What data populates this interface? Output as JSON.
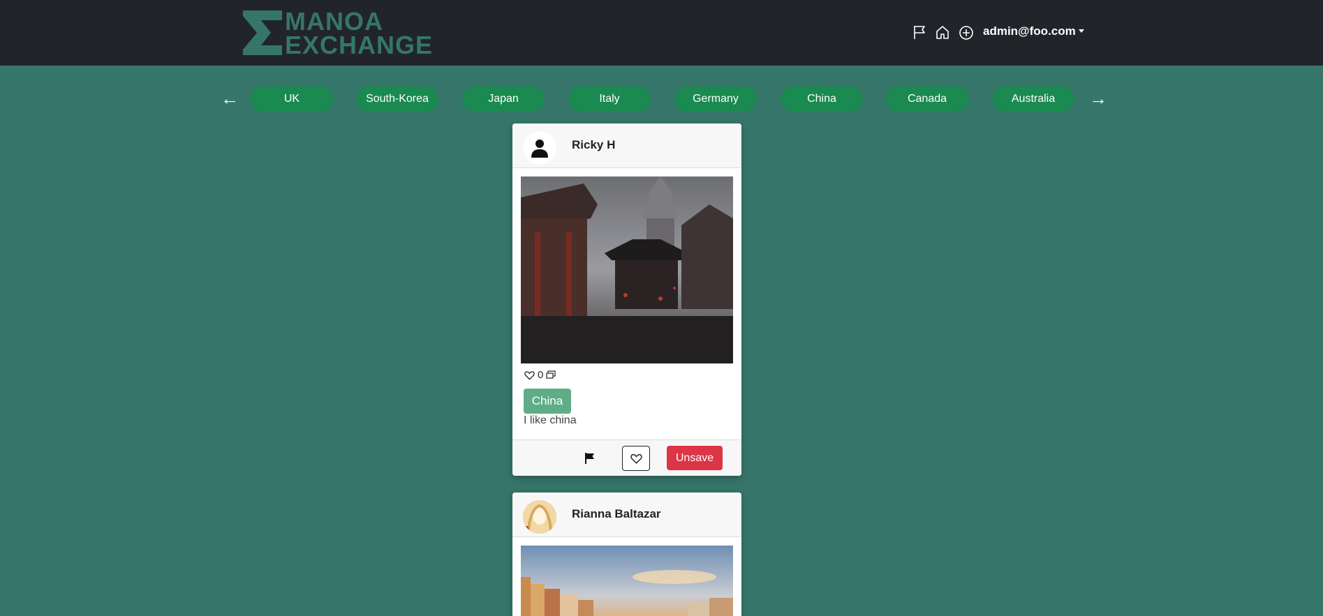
{
  "brand": {
    "line1": "MANOA",
    "line2": "EXCHANGE",
    "color": "#36756a"
  },
  "navbar": {
    "icons": [
      "flag-icon",
      "home-icon",
      "plus-circle-icon"
    ],
    "user": "admin@foo.com"
  },
  "carousel": {
    "prev": "←",
    "next": "→",
    "countries": [
      "UK",
      "South-Korea",
      "Japan",
      "Italy",
      "Germany",
      "China",
      "Canada",
      "Australia"
    ]
  },
  "posts": [
    {
      "author": "Ricky H",
      "likes": "0",
      "tag": "China",
      "caption": "I like china",
      "unsave_label": "Unsave"
    },
    {
      "author": "Rianna Baltazar"
    }
  ],
  "colors": {
    "background": "#36756a",
    "navbar": "#212529",
    "pill": "#1a8a50",
    "tag": "#5fad86",
    "danger": "#dc3545"
  }
}
